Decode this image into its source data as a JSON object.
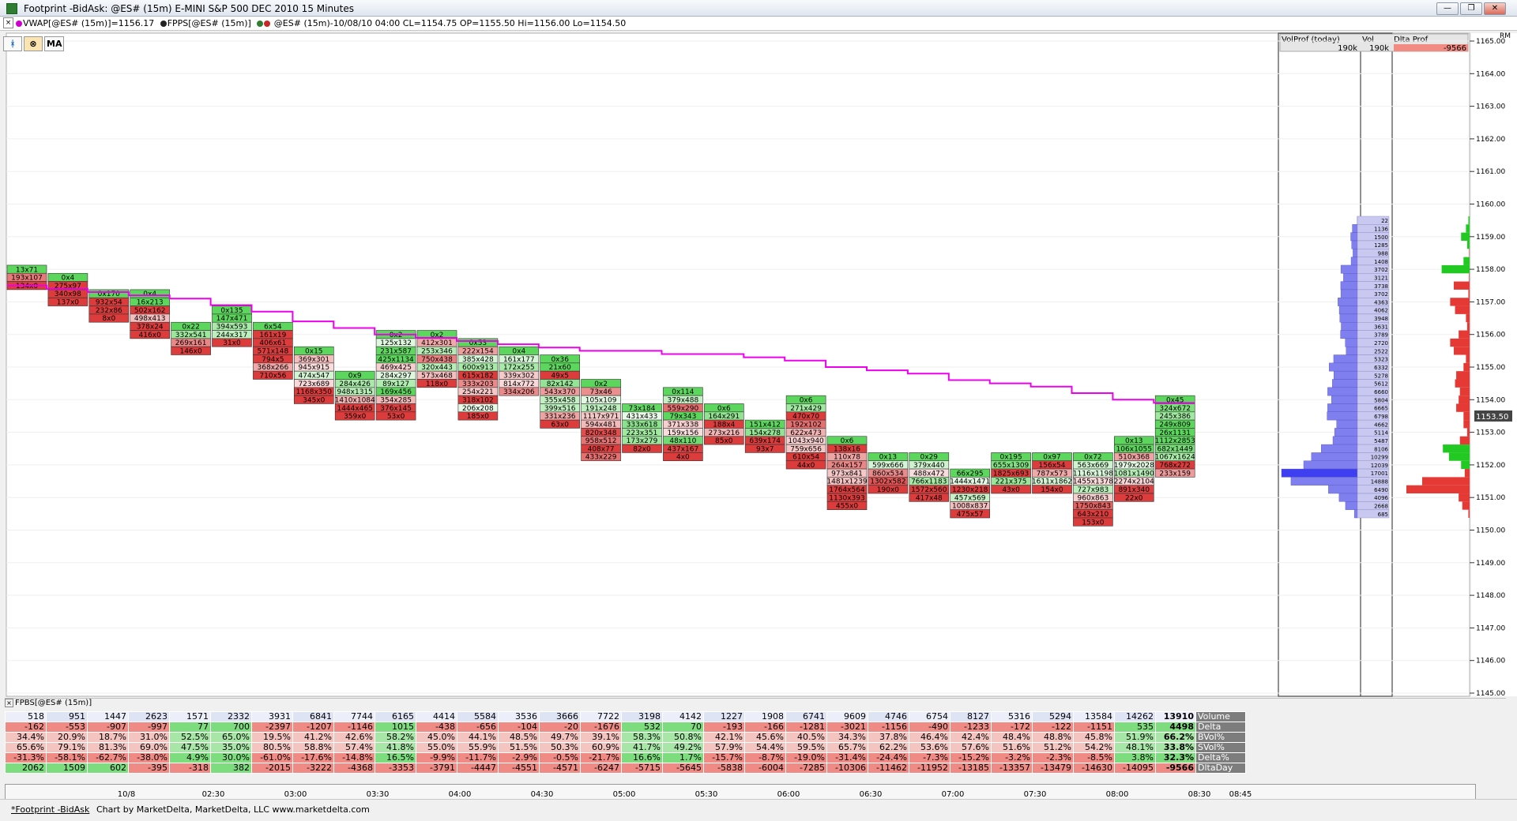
{
  "window": {
    "title": "Footprint  -BidAsk: @ES# (15m) E-MINI S&P 500 DEC 2010 15 Minutes",
    "minimize": "—",
    "maximize": "❐",
    "close": "✕"
  },
  "infobar": {
    "close": "×",
    "vwap": "VWAP[@ES# (15m)]=1156.17",
    "fpps": "FPPS[@ES# (15m)]",
    "bar_info": "@ES# (15m)-10/08/10 04:00 CL=1154.75 OP=1155.50 Hi=1156.00 Lo=1154.50",
    "colors": {
      "vwap": "#cc00cc",
      "fpps": "#222222",
      "dot1": "#2e7d32",
      "dot2": "#c62828"
    }
  },
  "toolbar": {
    "btn1_icon": "chart-icon",
    "btn2_icon": "target-icon",
    "ma_label": "MA"
  },
  "profile_header": {
    "volprof_label": "VolProf (today)",
    "vol_label": "Vol",
    "dltaprof_label": "Dlta Prof",
    "volprof_value": "190k",
    "vol_value": "190k",
    "dltaprof_value": "-9566"
  },
  "price_axis": {
    "labels": [
      "1165.00",
      "1164.00",
      "1163.00",
      "1162.00",
      "1161.00",
      "1160.00",
      "1159.00",
      "1158.00",
      "1157.00",
      "1156.00",
      "1155.00",
      "1154.00",
      "1153.00",
      "1152.00",
      "1151.00",
      "1150.00",
      "1149.00",
      "1148.00",
      "1147.00",
      "1146.00",
      "1145.00"
    ],
    "current_price": "1153.50",
    "rm_label": "RM"
  },
  "time_axis": {
    "labels": [
      "10/8",
      "02:30",
      "03:00",
      "03:30",
      "04:00",
      "04:30",
      "05:00",
      "05:30",
      "06:00",
      "06:30",
      "07:00",
      "07:30",
      "08:00",
      "08:30",
      "08:45"
    ]
  },
  "subpanel": {
    "close": "×",
    "label": "FPBS[@ES# (15m)]"
  },
  "stats": {
    "rows": [
      {
        "label": "Volume",
        "values": [
          "518",
          "951",
          "1447",
          "2623",
          "1571",
          "2332",
          "3931",
          "6841",
          "7744",
          "6165",
          "4414",
          "5584",
          "3536",
          "3666",
          "7722",
          "3198",
          "4142",
          "1227",
          "1908",
          "6741",
          "9609",
          "4746",
          "6754",
          "8127",
          "5316",
          "5294",
          "13584",
          "14262",
          "13910"
        ]
      },
      {
        "label": "Delta",
        "values": [
          "-162",
          "-553",
          "-907",
          "-997",
          "77",
          "700",
          "-2397",
          "-1207",
          "-1146",
          "1015",
          "-438",
          "-656",
          "-104",
          "-20",
          "-1676",
          "532",
          "70",
          "-193",
          "-166",
          "-1281",
          "-3021",
          "-1156",
          "-490",
          "-1233",
          "-172",
          "-122",
          "-1151",
          "535",
          "4498"
        ]
      },
      {
        "label": "BVol%",
        "values": [
          "34.4%",
          "20.9%",
          "18.7%",
          "31.0%",
          "52.5%",
          "65.0%",
          "19.5%",
          "41.2%",
          "42.6%",
          "58.2%",
          "45.0%",
          "44.1%",
          "48.5%",
          "49.7%",
          "39.1%",
          "58.3%",
          "50.8%",
          "42.1%",
          "45.6%",
          "40.5%",
          "34.3%",
          "37.8%",
          "46.4%",
          "42.4%",
          "48.4%",
          "48.8%",
          "45.8%",
          "51.9%",
          "66.2%"
        ]
      },
      {
        "label": "SVol%",
        "values": [
          "65.6%",
          "79.1%",
          "81.3%",
          "69.0%",
          "47.5%",
          "35.0%",
          "80.5%",
          "58.8%",
          "57.4%",
          "41.8%",
          "55.0%",
          "55.9%",
          "51.5%",
          "50.3%",
          "60.9%",
          "41.7%",
          "49.2%",
          "57.9%",
          "54.4%",
          "59.5%",
          "65.7%",
          "62.2%",
          "53.6%",
          "57.6%",
          "51.6%",
          "51.2%",
          "54.2%",
          "48.1%",
          "33.8%"
        ]
      },
      {
        "label": "Delta%",
        "values": [
          "-31.3%",
          "-58.1%",
          "-62.7%",
          "-38.0%",
          "4.9%",
          "30.0%",
          "-61.0%",
          "-17.6%",
          "-14.8%",
          "16.5%",
          "-9.9%",
          "-11.7%",
          "-2.9%",
          "-0.5%",
          "-21.7%",
          "16.6%",
          "1.7%",
          "-15.7%",
          "-8.7%",
          "-19.0%",
          "-31.4%",
          "-24.4%",
          "-7.3%",
          "-15.2%",
          "-3.2%",
          "-2.3%",
          "-8.5%",
          "3.8%",
          "32.3%"
        ]
      },
      {
        "label": "DltaDay",
        "values": [
          "2062",
          "1509",
          "602",
          "-395",
          "-318",
          "382",
          "-2015",
          "-3222",
          "-4368",
          "-3353",
          "-3791",
          "-4447",
          "-4551",
          "-4571",
          "-6247",
          "-5715",
          "-5645",
          "-5838",
          "-6004",
          "-7285",
          "-10306",
          "-11462",
          "-11952",
          "-13185",
          "-13357",
          "-13479",
          "-14630",
          "-14095",
          "-9566"
        ]
      }
    ]
  },
  "chart_data": {
    "type": "footprint",
    "symbol": "@ES# (15m)",
    "price_range": [
      1145.0,
      1165.0
    ],
    "tick": 0.25,
    "vwap": [
      1157.5,
      1157.4,
      1157.3,
      1157.2,
      1157.1,
      1156.9,
      1156.7,
      1156.4,
      1156.2,
      1156.0,
      1155.9,
      1155.8,
      1155.7,
      1155.6,
      1155.5,
      1155.5,
      1155.4,
      1155.4,
      1155.3,
      1155.2,
      1155.0,
      1154.9,
      1154.8,
      1154.6,
      1154.5,
      1154.4,
      1154.2,
      1154.0,
      1153.9
    ],
    "bars": [
      {
        "top": 1158.0,
        "cells": [
          "13x71",
          "193x107",
          "134x0"
        ]
      },
      {
        "top": 1157.75,
        "cells": [
          "0x4",
          "275x97",
          "340x98",
          "137x0"
        ]
      },
      {
        "top": 1157.25,
        "cells": [
          "0x170",
          "932x54",
          "232x86",
          "8x0"
        ]
      },
      {
        "top": 1157.25,
        "cells": [
          "0x4",
          "16x213",
          "502x162",
          "498x413",
          "378x24",
          "416x0"
        ]
      },
      {
        "top": 1156.25,
        "cells": [
          "0x22",
          "332x541",
          "269x161",
          "146x0"
        ]
      },
      {
        "top": 1156.75,
        "cells": [
          "0x135",
          "147x471",
          "394x593",
          "244x317",
          "31x0"
        ]
      },
      {
        "top": 1156.25,
        "cells": [
          "6x54",
          "161x19",
          "406x61",
          "571x148",
          "794x5",
          "368x266",
          "710x56"
        ]
      },
      {
        "top": 1155.5,
        "cells": [
          "0x15",
          "369x301",
          "945x915",
          "474x547",
          "723x689",
          "1168x350",
          "345x0"
        ]
      },
      {
        "top": 1154.75,
        "cells": [
          "0x9",
          "284x426",
          "948x1315",
          "1410x1084",
          "1444x465",
          "359x0"
        ]
      },
      {
        "top": 1156.0,
        "cells": [
          "0x2",
          "125x132",
          "231x587",
          "425x1134",
          "469x425",
          "284x297",
          "89x127",
          "169x456",
          "354x285",
          "376x145",
          "53x0"
        ]
      },
      {
        "top": 1156.0,
        "cells": [
          "0x2",
          "412x301",
          "253x346",
          "750x438",
          "320x443",
          "573x468",
          "118x0"
        ]
      },
      {
        "top": 1155.75,
        "cells": [
          "0x53",
          "222x154",
          "385x428",
          "600x913",
          "615x182",
          "333x203",
          "254x221",
          "318x102",
          "206x208",
          "185x0"
        ]
      },
      {
        "top": 1155.5,
        "cells": [
          "0x4",
          "161x177",
          "172x255",
          "339x302",
          "814x772",
          "334x206"
        ]
      },
      {
        "top": 1155.25,
        "cells": [
          "0x36",
          "21x60",
          "49x5",
          "82x142",
          "543x370",
          "355x458",
          "399x516",
          "331x236",
          "63x0"
        ]
      },
      {
        "top": 1154.5,
        "cells": [
          "0x2",
          "73x46",
          "105x109",
          "191x248",
          "1117x971",
          "594x481",
          "820x348",
          "958x512",
          "408x77",
          "433x229"
        ]
      },
      {
        "top": 1153.75,
        "cells": [
          "73x184",
          "431x433",
          "333x618",
          "223x351",
          "173x279",
          "82x0"
        ]
      },
      {
        "top": 1154.25,
        "cells": [
          "0x114",
          "379x488",
          "559x290",
          "79x343",
          "371x338",
          "159x156",
          "48x110",
          "437x167",
          "4x0"
        ]
      },
      {
        "top": 1153.75,
        "cells": [
          "0x6",
          "164x291",
          "188x4",
          "273x216",
          "85x0"
        ]
      },
      {
        "top": 1153.25,
        "cells": [
          "151x412",
          "154x278",
          "639x174",
          "93x7"
        ]
      },
      {
        "top": 1154.0,
        "cells": [
          "0x6",
          "271x429",
          "470x70",
          "192x102",
          "622x473",
          "1043x940",
          "759x656",
          "610x54",
          "44x0"
        ]
      },
      {
        "top": 1152.75,
        "cells": [
          "0x6",
          "138x16",
          "110x78",
          "264x157",
          "973x841",
          "1481x1239",
          "1764x564",
          "1130x393",
          "455x0"
        ]
      },
      {
        "top": 1152.25,
        "cells": [
          "0x13",
          "599x666",
          "860x534",
          "1302x582",
          "190x0"
        ]
      },
      {
        "top": 1152.25,
        "cells": [
          "0x29",
          "379x440",
          "488x472",
          "766x1183",
          "1572x560",
          "417x48"
        ]
      },
      {
        "top": 1151.75,
        "cells": [
          "66x295",
          "1444x1471",
          "1230x218",
          "457x569",
          "1008x837",
          "475x57"
        ]
      },
      {
        "top": 1152.25,
        "cells": [
          "0x195",
          "655x1309",
          "1825x693",
          "221x375",
          "43x0"
        ]
      },
      {
        "top": 1152.25,
        "cells": [
          "0x97",
          "156x54",
          "787x573",
          "1611x1862",
          "154x0"
        ]
      },
      {
        "top": 1152.25,
        "cells": [
          "0x72",
          "563x669",
          "1116x1198",
          "1455x1378",
          "727x983",
          "960x863",
          "1750x843",
          "643x210",
          "153x0"
        ]
      },
      {
        "top": 1152.75,
        "cells": [
          "0x13",
          "106x1055",
          "510x368",
          "1979x2028",
          "1081x1490",
          "2274x2104",
          "891x340",
          "22x0"
        ]
      },
      {
        "top": 1154.0,
        "cells": [
          "0x45",
          "324x672",
          "245x386",
          "249x809",
          "26x1131",
          "1112x2853",
          "682x1449",
          "1067x1624",
          "768x272",
          "233x159"
        ]
      }
    ],
    "volume_profile": {
      "prices": [
        1159.5,
        1159.25,
        1159.0,
        1158.75,
        1158.5,
        1158.25,
        1158.0,
        1157.75,
        1157.5,
        1157.25,
        1157.0,
        1156.75,
        1156.5,
        1156.25,
        1156.0,
        1155.75,
        1155.5,
        1155.25,
        1155.0,
        1154.75,
        1154.5,
        1154.25,
        1154.0,
        1153.75,
        1153.5,
        1153.25,
        1153.0,
        1152.75,
        1152.5,
        1152.25,
        1152.0,
        1151.75,
        1151.5,
        1151.25,
        1151.0,
        1150.75,
        1150.5
      ],
      "volumes": [
        22,
        1136,
        1500,
        1285,
        988,
        1408,
        3702,
        3121,
        3738,
        3702,
        4363,
        4062,
        3948,
        3631,
        3789,
        2720,
        2522,
        5323,
        6332,
        5278,
        5612,
        6660,
        5804,
        6665,
        6798,
        4662,
        5114,
        5487,
        8106,
        10299,
        12039,
        17001,
        14888,
        6490,
        4096,
        2668,
        685
      ]
    },
    "delta_profile": {
      "prices": [
        1159.5,
        1159.25,
        1159.0,
        1158.75,
        1158.5,
        1158.25,
        1158.0,
        1157.75,
        1157.5,
        1157.25,
        1157.0,
        1156.75,
        1156.5,
        1156.25,
        1156.0,
        1155.75,
        1155.5,
        1155.25,
        1155.0,
        1154.75,
        1154.5,
        1154.25,
        1154.0,
        1153.75,
        1153.5,
        1153.25,
        1153.0,
        1152.75,
        1152.5,
        1152.25,
        1152.0,
        1151.75,
        1151.5,
        1151.25,
        1151.0,
        1150.75,
        1150.5
      ],
      "deltas": [
        100,
        300,
        700,
        200,
        -40,
        500,
        2300,
        -50,
        -1300,
        -100,
        -1600,
        -1200,
        -300,
        -200,
        -900,
        -1600,
        -1300,
        -300,
        -500,
        -1100,
        -1200,
        -800,
        -900,
        -1100,
        -500,
        -500,
        -200,
        -800,
        2200,
        1700,
        700,
        -400,
        -3900,
        -5200,
        -900,
        -600,
        -100
      ]
    }
  }
}
